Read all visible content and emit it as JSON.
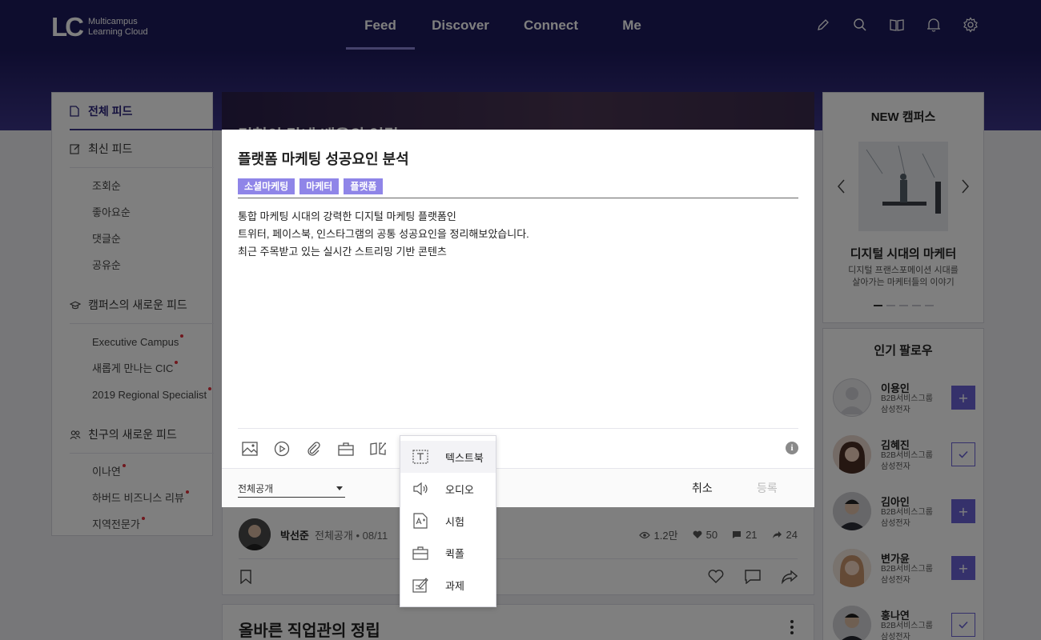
{
  "brand": {
    "logo_mark": "LC",
    "logo_line1": "Multicampus",
    "logo_line2": "Learning Cloud"
  },
  "nav": [
    {
      "label": "Feed",
      "active": true
    },
    {
      "label": "Discover",
      "active": false
    },
    {
      "label": "Connect",
      "active": false
    },
    {
      "label": "Me",
      "active": false
    }
  ],
  "header_icons": [
    "pencil-icon",
    "search-icon",
    "book-icon",
    "bell-icon",
    "gear-icon"
  ],
  "sidebar": {
    "all_feed": "전체 피드",
    "recent_feed": "최신 피드",
    "recent_items": [
      "조회순",
      "좋아요순",
      "댓글순",
      "공유순"
    ],
    "campus_feed": "캠퍼스의 새로운 피드",
    "campus_items": [
      "Executive Campus",
      "새롭게 만나는 CIC",
      "2019 Regional Specialist"
    ],
    "friends_feed": "친구의 새로운 피드",
    "friend_items": [
      "이나연",
      "하버드 비즈니스 리뷰",
      "지역전문가"
    ]
  },
  "banner": {
    "text": "경험이 닿내 배움의 연결"
  },
  "modal": {
    "title": "플랫폼 마케팅 성공요인 분석",
    "tags": [
      "소셜마케팅",
      "마케터",
      "플랫폼"
    ],
    "body_lines": [
      "통합 마케팅 시대의 강력한 디지털 마케팅 플랫폼인",
      "트위터, 페이스북, 인스타그램의 공통 성공요인을 정리해보았습니다.",
      "최근 주목받고 있는 실시간 스트리밍 기반 콘텐츠"
    ],
    "toolbar_icons": [
      "image-icon",
      "video-icon",
      "attachment-icon",
      "briefcase-icon",
      "book-edit-icon"
    ],
    "info_glyph": "i",
    "visibility": "전체공개",
    "cancel_label": "취소",
    "submit_label": "등록"
  },
  "dropdown": [
    {
      "label": "텍스트북",
      "icon": "textbook-icon"
    },
    {
      "label": "오디오",
      "icon": "speaker-icon"
    },
    {
      "label": "시험",
      "icon": "exam-icon"
    },
    {
      "label": "퀵폴",
      "icon": "quickpoll-icon"
    },
    {
      "label": "과제",
      "icon": "assignment-icon"
    }
  ],
  "post": {
    "author": "박선준",
    "meta": "전체공개 • 08/11",
    "views": "1.2만",
    "likes": "50",
    "comments": "21",
    "shares": "24"
  },
  "post2": {
    "title": "올바른 직업관의 정립"
  },
  "campus": {
    "title": "NEW 캠퍼스",
    "name": "디지털 시대의 마케터",
    "desc_line1": "디지털 프랜스포메이션 시대를",
    "desc_line2": "살아가는 마케터들의 이야기",
    "active_slide": 1,
    "slide_count": 5
  },
  "follow": {
    "title": "인기 팔로우",
    "people": [
      {
        "name": "이용인",
        "org1": "B2B서비스그룹",
        "org2": "삼성전자",
        "following": false
      },
      {
        "name": "김혜진",
        "org1": "B2B서비스그룹",
        "org2": "삼성전자",
        "following": true
      },
      {
        "name": "김아인",
        "org1": "B2B서비스그룹",
        "org2": "삼성전자",
        "following": false
      },
      {
        "name": "변가윤",
        "org1": "B2B서비스그룹",
        "org2": "삼성전자",
        "following": false
      },
      {
        "name": "홍나연",
        "org1": "B2B서비스그룹",
        "org2": "삼성전자",
        "following": true
      }
    ]
  },
  "colors": {
    "header_bg": "#1d1a5c",
    "accent": "#6b63d6",
    "tag_bg": "#8f85e8",
    "notify_dot": "#e0303c"
  }
}
